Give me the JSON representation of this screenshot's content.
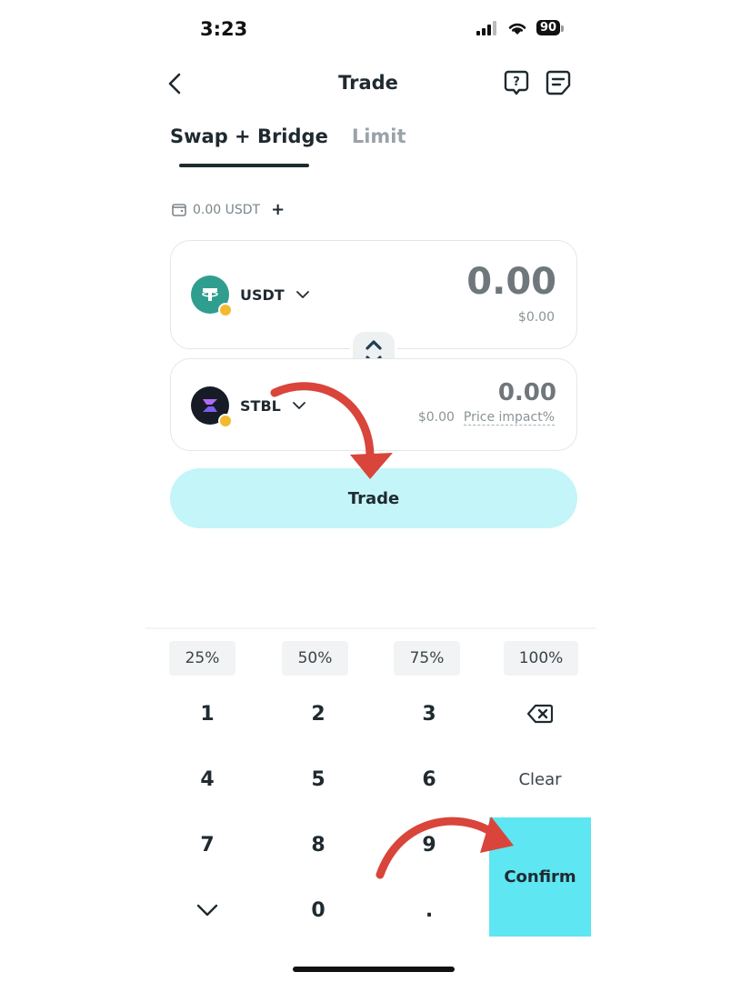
{
  "status_bar": {
    "time": "3:23",
    "battery": "90"
  },
  "nav": {
    "title": "Trade",
    "back_icon": "chevron-left-icon",
    "help_icon": "help-icon",
    "history_icon": "receipt-icon"
  },
  "tabs": [
    {
      "label": "Swap + Bridge",
      "active": true
    },
    {
      "label": "Limit",
      "active": false
    }
  ],
  "balance": {
    "value": "0.00 USDT",
    "add": "+"
  },
  "from_token": {
    "symbol": "USDT",
    "amount": "0.00",
    "usd_value": "$0.00"
  },
  "to_token": {
    "symbol": "STBL",
    "amount": "0.00",
    "usd_value": "$0.00",
    "price_impact_label": "Price impact%"
  },
  "trade_button": {
    "label": "Trade"
  },
  "percent_buttons": [
    "25%",
    "50%",
    "75%",
    "100%"
  ],
  "keypad": {
    "keys": [
      "1",
      "2",
      "3",
      "4",
      "5",
      "6",
      "7",
      "8",
      "9",
      "0",
      "."
    ],
    "clear": "Clear",
    "confirm": "Confirm",
    "backspace_icon": "backspace-icon",
    "collapse_icon": "chevron-down-icon"
  },
  "colors": {
    "accent": "#5ee6f2",
    "trade_button_bg": "#c4f5f8",
    "annotation_arrow": "#d9453a",
    "usdt": "#2f9e8f",
    "stbl": "#161b26"
  }
}
